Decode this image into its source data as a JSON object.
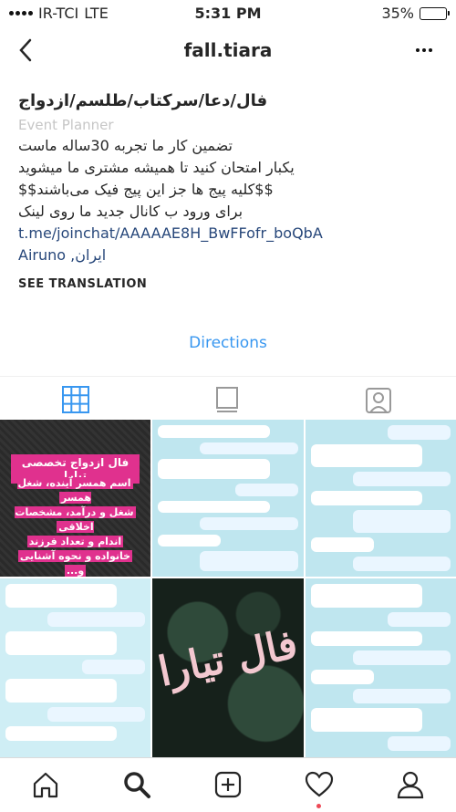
{
  "status_bar": {
    "carrier": "IR-TCI",
    "network": "LTE",
    "time": "5:31 PM",
    "battery_percent": "35%",
    "battery_level": 0.35
  },
  "nav": {
    "title": "fall.tiara"
  },
  "bio": {
    "name": "فال/دعا/سرکتاب/طلسم/ازدواج",
    "category": "Event Planner",
    "lines": [
      "تضمین کار ما تجربه 30ساله ماست",
      "یکبار امتحان کنید تا همیشه مشتری ما میشوید",
      "$$کلیه پیج ها جز این پیج فیک می‌باشند$$",
      "برای ورود ب کانال جدید ما روی لینک"
    ],
    "link": "t.me/joinchat/AAAAAE8H_BwFFofr_boQbA",
    "location": "ایران, Airuno",
    "see_translation": "SEE TRANSLATION"
  },
  "directions": "Directions",
  "tabs": {
    "grid_icon": "grid-icon",
    "feed_icon": "feed-icon",
    "tagged_icon": "tagged-icon"
  },
  "posts": {
    "promo_heading": "فال ازدواج تخصصی تیارا",
    "promo_body": [
      "اسم همسر آینده، شغل همسر",
      "شغل و درآمد، مشخصات اخلاقی",
      "اندام و تعداد فرزند",
      "خانواده و نحوه آشنایی",
      "و..."
    ],
    "logo_text": "فال تیارا"
  },
  "tabbar": {
    "items": [
      "home-icon",
      "search-icon",
      "add-icon",
      "heart-icon",
      "profile-icon"
    ]
  },
  "colors": {
    "link": "#27477a",
    "accent_blue": "#3897f0",
    "notification": "#ed4956",
    "promo_pink": "#e0318e"
  }
}
